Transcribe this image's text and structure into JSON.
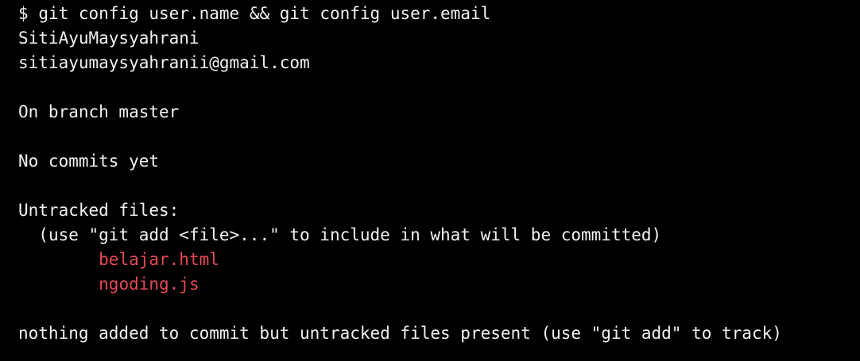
{
  "terminal": {
    "prompt": "$",
    "command": "git config user.name && git config user.email",
    "config_name": "SitiAyuMaysyahrani",
    "config_email": "sitiayumaysyahranii@gmail.com",
    "branch_line": "On branch master",
    "commits_line": "No commits yet",
    "untracked_header": "Untracked files:",
    "untracked_hint": "(use \"git add <file>...\" to include in what will be committed)",
    "untracked_files": [
      "belajar.html",
      "ngoding.js"
    ],
    "summary_line": "nothing added to commit but untracked files present (use \"git add\" to track)"
  },
  "colors": {
    "background": "#000000",
    "text": "#f2f2f2",
    "untracked_file": "#e74856"
  }
}
